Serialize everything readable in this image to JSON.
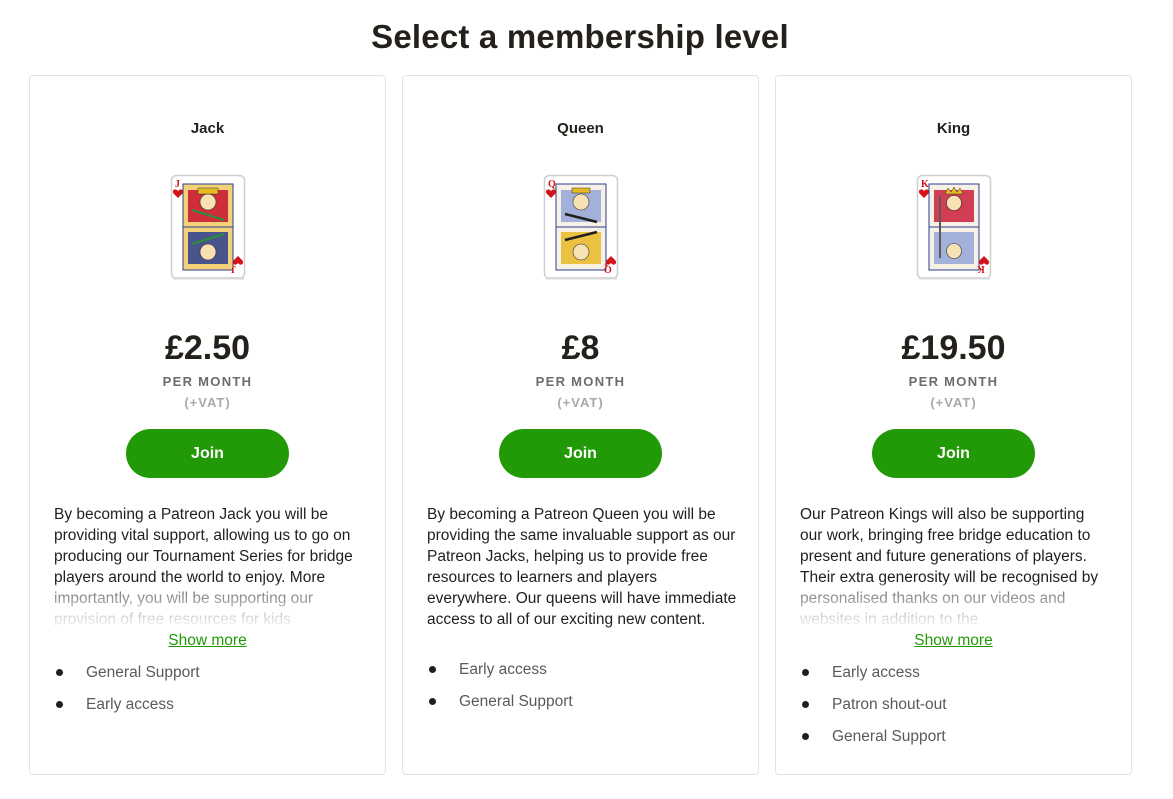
{
  "page": {
    "title": "Select a membership level"
  },
  "colors": {
    "accent": "#229a07",
    "card_red": "#d3141b"
  },
  "tiers": [
    {
      "name": "Jack",
      "card_icon": "jack-of-hearts-card-icon",
      "price": "£2.50",
      "period": "PER MONTH",
      "vat": "(+VAT)",
      "join_label": "Join",
      "description": "By becoming a Patreon Jack you will be providing vital support, allowing us to go on producing our Tournament Series for bridge players around the world to enjoy. More importantly, you will be supporting our provision of free resources for kids",
      "show_more_label": "Show more",
      "benefits": [
        "General Support",
        "Early access"
      ]
    },
    {
      "name": "Queen",
      "card_icon": "queen-of-hearts-card-icon",
      "price": "£8",
      "period": "PER MONTH",
      "vat": "(+VAT)",
      "join_label": "Join",
      "description": "By becoming a Patreon Queen you will be providing the same invaluable support as our Patreon Jacks, helping us to provide free resources to learners and players everywhere. Our queens will have immediate access to all of our exciting new content.",
      "benefits": [
        "Early access",
        "General Support"
      ]
    },
    {
      "name": "King",
      "card_icon": "king-of-hearts-card-icon",
      "price": "£19.50",
      "period": "PER MONTH",
      "vat": "(+VAT)",
      "join_label": "Join",
      "description": "Our Patreon Kings will also be supporting our work, bringing free bridge education to present and future generations of players.  Their extra generosity will be recognised by personalised thanks on our videos and websites in addition to the",
      "show_more_label": "Show more",
      "benefits": [
        "Early access",
        "Patron shout-out",
        "General Support"
      ]
    }
  ]
}
